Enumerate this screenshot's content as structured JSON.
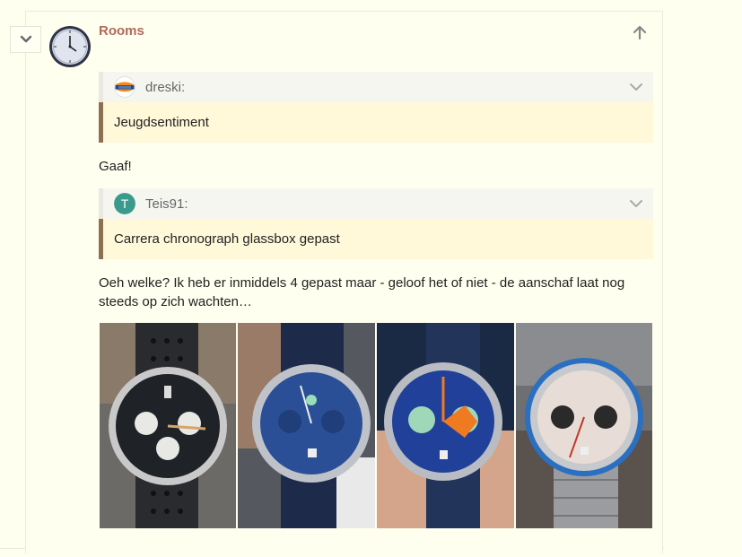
{
  "post": {
    "username": "Rooms",
    "avatar_icon": "wall-clock-avatar",
    "quote1": {
      "author": "dreski:",
      "avatar_icon": "dreski-logo-avatar",
      "text": "Jeugdsentiment"
    },
    "reply1": "Gaaf!",
    "quote2": {
      "author": "Teis91:",
      "avatar_letter": "T",
      "avatar_color": "#3a9a8c",
      "text": "Carrera chronograph glassbox gepast"
    },
    "reply2": "Oeh welke? Ik heb er inmiddels 4 gepast maar - geloof het of niet - de aanschaf laat nog steeds op zich wachten…",
    "photos": [
      {
        "name": "black-carrera-chronograph-photo",
        "dial_color": "#1f2226",
        "subdial_color": "#e8e8e4",
        "strap_color": "#2a2b2e"
      },
      {
        "name": "blue-carrera-chronograph-photo",
        "dial_color": "#2b4f96",
        "subdial_color": "#2b4f96",
        "strap_color": "#1d2a4a"
      },
      {
        "name": "blue-orange-carrera-chronograph-photo",
        "dial_color": "#21409a",
        "subdial_color": "#9fd8b8",
        "strap_color": "#22345a"
      },
      {
        "name": "silver-panda-carrera-chronograph-photo",
        "dial_color": "#e7ddd6",
        "subdial_color": "#2a2a2a",
        "strap_color": "#9a9ca0"
      }
    ]
  }
}
